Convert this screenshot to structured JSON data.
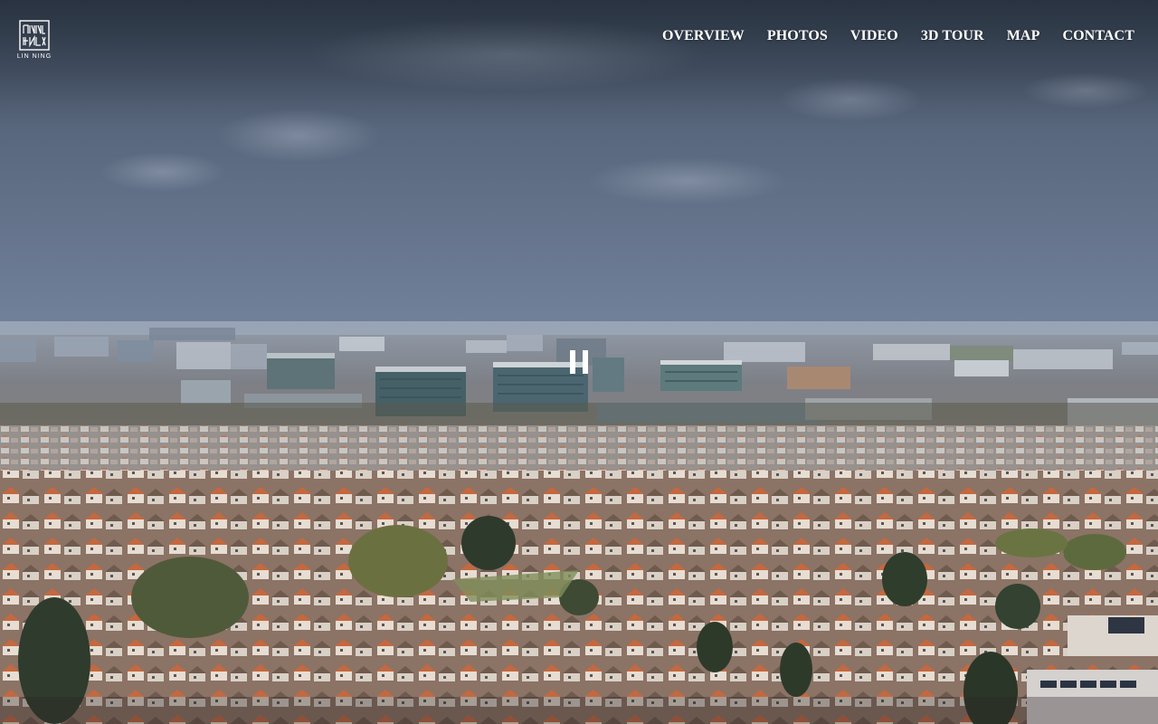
{
  "brand": {
    "name": "LIN NING"
  },
  "nav": {
    "items": [
      {
        "label": "OVERVIEW"
      },
      {
        "label": "PHOTOS"
      },
      {
        "label": "VIDEO"
      },
      {
        "label": "3D TOUR"
      },
      {
        "label": "MAP"
      },
      {
        "label": "CONTACT"
      }
    ]
  },
  "video": {
    "state": "playing",
    "control_icon": "pause-icon"
  },
  "colors": {
    "nav_text": "#ffffff",
    "sky_top": "#3d4b5e",
    "sky_mid": "#7b8aa3",
    "haze": "#9aa6b8",
    "roof_terracotta": "#c0643e",
    "roof_brown": "#6e5a4e"
  }
}
